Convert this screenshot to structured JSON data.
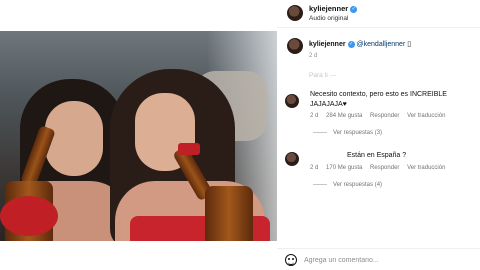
{
  "post": {
    "author": "kyliejenner",
    "audio": "Audio original",
    "caption_mention": "@kendalljenner",
    "caption_time": "2 d",
    "caption_faded": "Para ti ---"
  },
  "comments": [
    {
      "text": "Necesito contexto, pero esto es INCREIBLE",
      "text_cont": "JAJAJAJA♥",
      "time": "2 d",
      "likes": "284 Me gusta",
      "reply": "Responder",
      "translate": "Ver traducción",
      "replies": "Ver respuestas (3)"
    },
    {
      "text": "Están en España ?",
      "time": "2 d",
      "likes": "170 Me gusta",
      "reply": "Responder",
      "translate": "Ver traducción",
      "replies": "Ver respuestas (4)"
    }
  ],
  "footer": {
    "placeholder": "Agrega un comentario..."
  },
  "icons": {
    "verified": "verified-badge-icon",
    "mute": "muted-speaker-icon",
    "heart": "heart-icon",
    "emoji": "emoji-smiley-icon"
  },
  "colors": {
    "verified": "#3897f0",
    "mention": "#00376b",
    "muted_text": "#737373"
  }
}
